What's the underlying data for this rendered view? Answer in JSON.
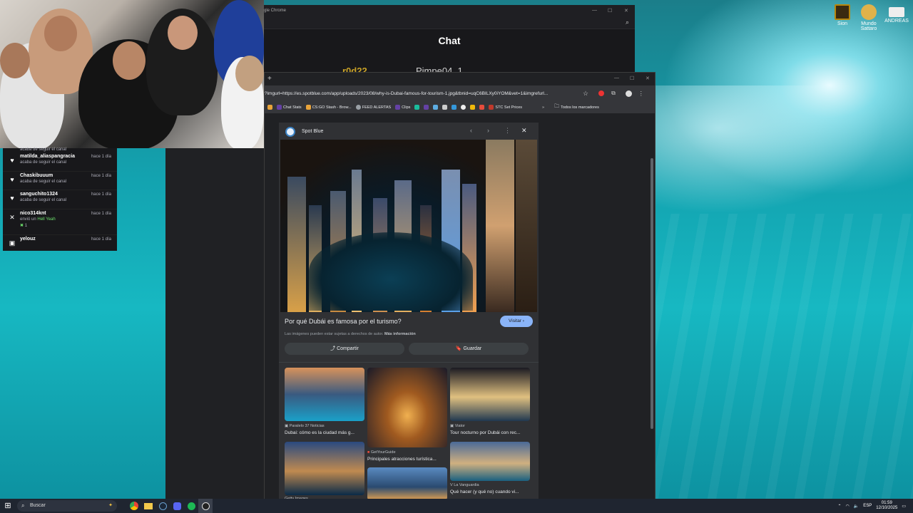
{
  "desktop": {
    "icons": [
      {
        "label": "Sion",
        "color": "#b8860b"
      },
      {
        "label": "Mundo Sattaro",
        "color": "#e0b24a"
      },
      {
        "label": "ANDREAS",
        "color": "#d8d8d8"
      }
    ]
  },
  "follows": {
    "top_partial": "acaba de seguir el canal",
    "rows": [
      {
        "icon": "heart-icon",
        "glyph": "♥",
        "name": "matilda_aliaspangracia",
        "sub": "acaba de seguir el canal",
        "time": "hace 1 día"
      },
      {
        "icon": "heart-icon",
        "glyph": "♥",
        "name": "Chaskibuuum",
        "sub": "acaba de seguir el canal",
        "time": "hace 1 día"
      },
      {
        "icon": "heart-icon",
        "glyph": "♥",
        "name": "sanguchito1324",
        "sub": "acaba de seguir el canal",
        "time": "hace 1 día"
      },
      {
        "icon": "gift-icon",
        "glyph": "✕",
        "name": "nico314knt",
        "sub_prefix": "envió un",
        "sub_highlight": "Hell Yeah",
        "count": "1",
        "time": "hace 1 día"
      },
      {
        "icon": "gift-icon",
        "glyph": "▣",
        "name": "yelouz",
        "sub": "",
        "time": "hace 1 día"
      }
    ]
  },
  "chat_window": {
    "titlebar": "gle Chrome",
    "title": "Chat",
    "users": [
      "r0d22",
      "Pimpe04_1"
    ]
  },
  "chrome": {
    "url": "?imgurl=https://es.spotblue.com/app/uploads/2023/08/why-is-Dubai-famous-for-tourism-1.jpg&tbnid=uqC6BILXy0iYOM&vet=1&imgrefurl...",
    "bookmarks": [
      {
        "label": "Chat Stats",
        "color": "#6441a5"
      },
      {
        "label": "CS:GO Stash - Brow...",
        "color": "#e8a33a"
      },
      {
        "label": "FEED ALERTAS",
        "color": "#9aa0a6"
      },
      {
        "label": "Clips",
        "color": "#6441a5"
      },
      {
        "label": "STC Set Prices",
        "color": "#c0392b"
      }
    ],
    "all_bookmarks": "Todos los marcadores"
  },
  "image_panel": {
    "site_name": "Spot Blue",
    "title": "Por qué Dubái es famosa por el turismo?",
    "visit_label": "Visitar",
    "copyright": "Las imágenes pueden estar sujetas a derechos de autor.",
    "more_info": "Más información",
    "share_label": "Compartir",
    "save_label": "Guardar"
  },
  "related": [
    {
      "source": "Paralelo 37 Noticias",
      "title": "Dubai: cómo es la ciudad más g..."
    },
    {
      "source": "GetYourGuide",
      "title": "Principales atracciones turística..."
    },
    {
      "source": "Viator",
      "title": "Tour nocturno por Dubái con rec..."
    },
    {
      "source": "La Vanguardia",
      "title": "Qué hacer (y qué no) cuando vi..."
    },
    {
      "source": "Getty Images",
      "title": ""
    }
  ],
  "taskbar": {
    "search_placeholder": "Buscar",
    "lang": "ESP",
    "time": "01:59",
    "date": "12/10/2025"
  }
}
